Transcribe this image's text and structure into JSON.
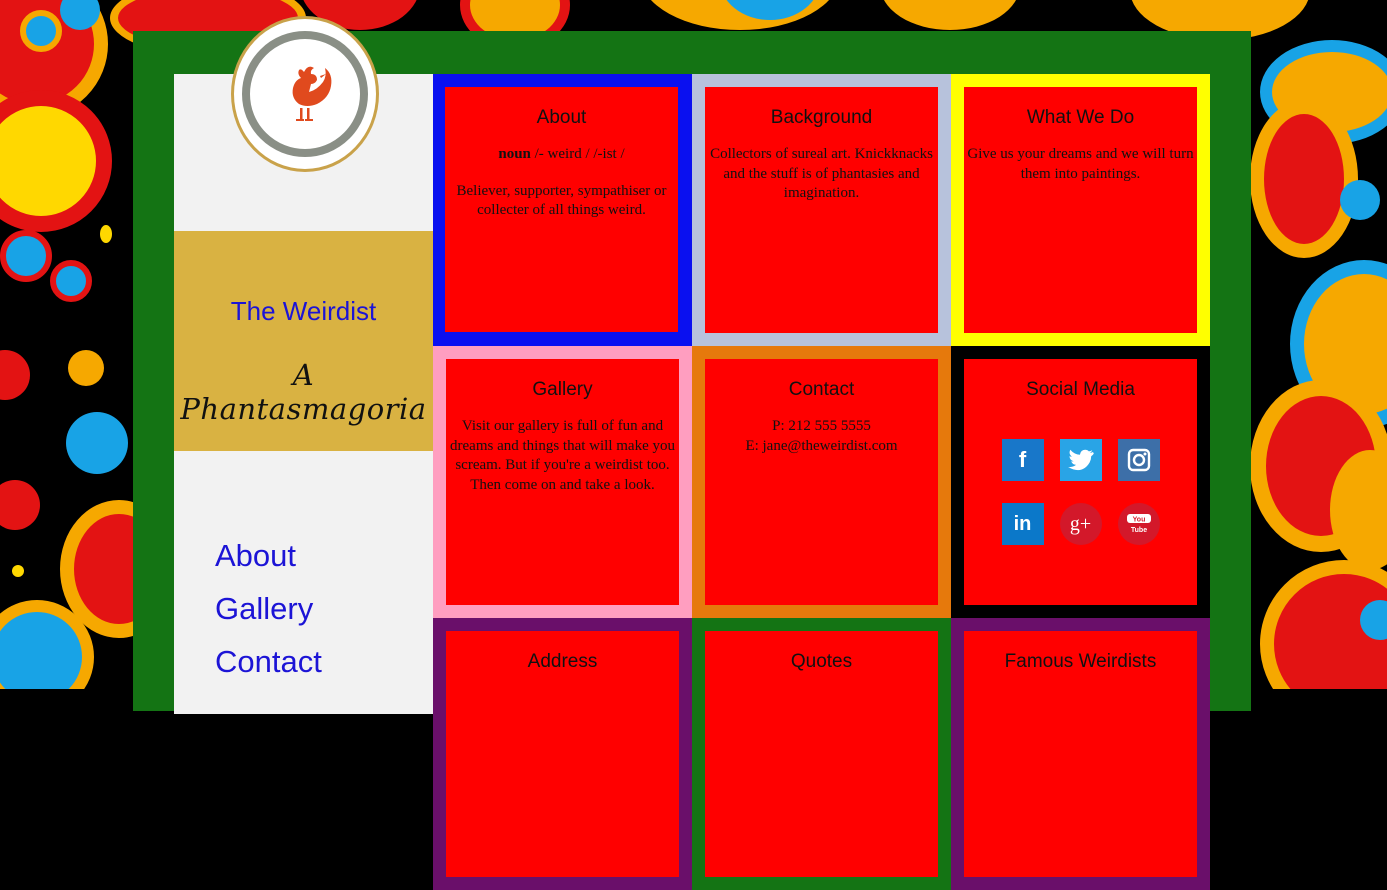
{
  "site": {
    "title": "The Weirdist",
    "subtitle": "A Phantasmagoria",
    "logo_icon": "rooster-icon"
  },
  "nav": {
    "items": [
      {
        "label": "About"
      },
      {
        "label": "Gallery"
      },
      {
        "label": "Contact"
      }
    ]
  },
  "tiles": {
    "about": {
      "title": "About",
      "noun_label": "noun",
      "pronunciation": " /- weird / /-ist /",
      "body": "Believer, supporter, sympathiser or collecter of all things weird.",
      "border_color": "#0a10f0"
    },
    "background": {
      "title": "Background",
      "body": "Collectors of sureal art. Knickknacks and the stuff is of phantasies and imagination.",
      "border_color": "#b7c2dc"
    },
    "what_we_do": {
      "title": "What We Do",
      "body": "Give us your dreams and we will turn them into paintings.",
      "border_color": "#ffff00"
    },
    "gallery": {
      "title": "Gallery",
      "body": "Visit our gallery is full of fun and dreams and things that will make you scream. But if you're a weirdist too. Then come on and take a look.",
      "border_color": "#ff9ec0"
    },
    "contact": {
      "title": "Contact",
      "phone": "P: 212 555 5555",
      "email": "E: jane@theweirdist.com",
      "border_color": "#e6790c"
    },
    "social": {
      "title": "Social Media",
      "border_color": "#000000",
      "icons": [
        {
          "name": "facebook-icon",
          "glyph": "f",
          "color": "#1877c9"
        },
        {
          "name": "twitter-icon",
          "glyph": "t",
          "color": "#29a4e6"
        },
        {
          "name": "instagram-icon",
          "glyph": "◎",
          "color": "#3d6fa8"
        },
        {
          "name": "linkedin-icon",
          "glyph": "in",
          "color": "#0b78c9"
        },
        {
          "name": "google-plus-icon",
          "glyph": "g+",
          "color": "#d3182a"
        },
        {
          "name": "youtube-icon",
          "glyph": "You Tube",
          "color": "#d3182a"
        }
      ]
    },
    "address": {
      "title": "Address",
      "border_color": "#6a0f6a"
    },
    "quotes": {
      "title": "Quotes",
      "border_color": "#147414"
    },
    "famous": {
      "title": "Famous Weirdists",
      "border_color": "#6a0f6a"
    }
  }
}
